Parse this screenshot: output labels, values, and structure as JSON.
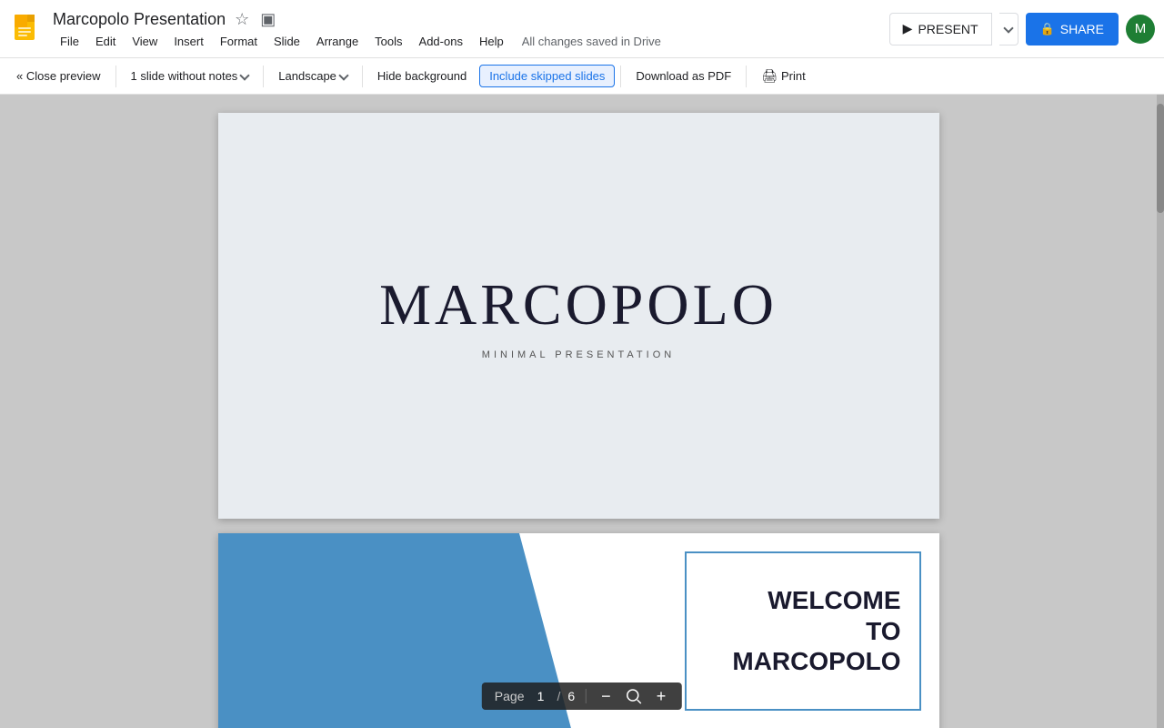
{
  "app": {
    "icon_label": "Google Slides",
    "title": "Marcopolo Presentation",
    "save_status": "All changes saved in Drive"
  },
  "menu": {
    "items": [
      "File",
      "Edit",
      "View",
      "Insert",
      "Format",
      "Slide",
      "Arrange",
      "Tools",
      "Add-ons",
      "Help"
    ]
  },
  "toolbar": {
    "close_preview": "« Close preview",
    "slide_notes": "1 slide without notes",
    "orientation": "Landscape",
    "hide_background": "Hide background",
    "include_skipped": "Include skipped slides",
    "download_pdf": "Download as PDF",
    "print": "Print"
  },
  "header_buttons": {
    "present": "PRESENT",
    "share": "SHARE",
    "avatar_initial": "M"
  },
  "slide1": {
    "title": "MARCOPOLO",
    "subtitle": "MINIMAL PRESENTATION"
  },
  "slide2": {
    "welcome_line1": "WELCOME",
    "welcome_line2": "TO",
    "welcome_line3": "MARCOPOLO"
  },
  "page_controls": {
    "label": "Page",
    "current": "1",
    "separator": "/",
    "total": "6"
  },
  "colors": {
    "accent_blue": "#1a73e8",
    "present_bg": "#ffffff",
    "share_bg": "#1a73e8",
    "slide2_blue": "#4a90c4",
    "active_btn": "#e8f0fe"
  }
}
